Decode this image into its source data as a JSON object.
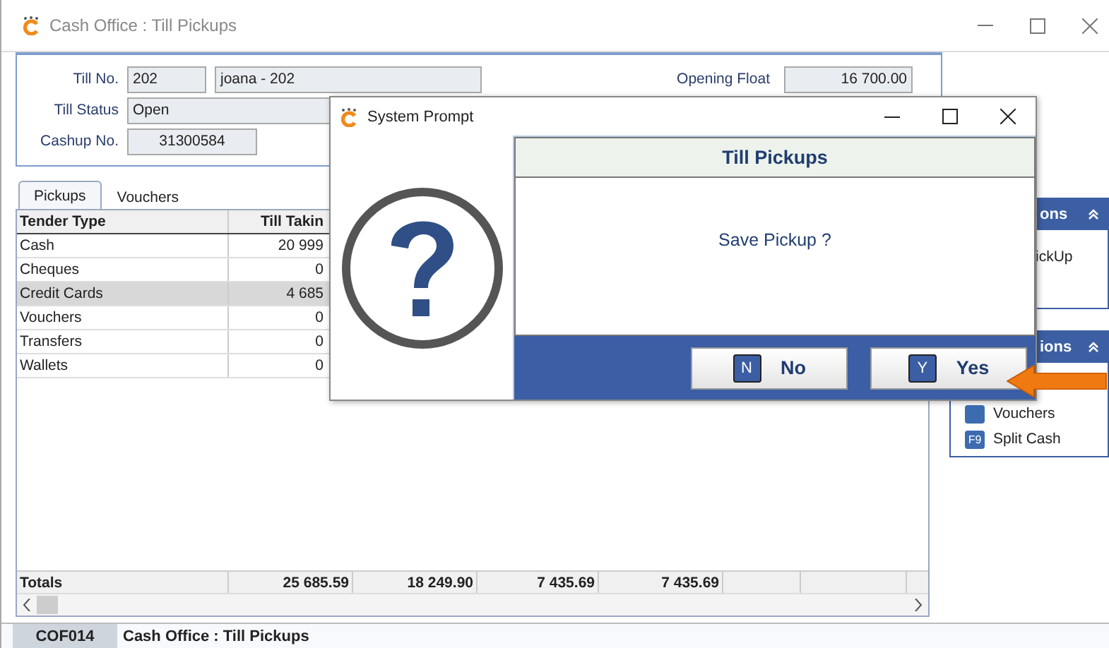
{
  "window": {
    "title": "Cash Office : Till Pickups"
  },
  "form": {
    "till_no": {
      "label": "Till No.",
      "value": "202",
      "name": "joana - 202"
    },
    "till_status": {
      "label": "Till Status",
      "value": "Open"
    },
    "cashup_no": {
      "label": "Cashup No.",
      "value": "31300584"
    },
    "opening_float": {
      "label": "Opening Float",
      "value": "16 700.00"
    }
  },
  "tabs": [
    {
      "label": "Pickups",
      "selected": true
    },
    {
      "label": "Vouchers",
      "selected": false
    }
  ],
  "table": {
    "columns": [
      "Tender Type",
      "Till Takin"
    ],
    "rows": [
      {
        "cells": [
          "Cash",
          "20 999"
        ],
        "selected": false
      },
      {
        "cells": [
          "Cheques",
          "0"
        ],
        "selected": false
      },
      {
        "cells": [
          "Credit Cards",
          "4 685"
        ],
        "selected": true
      },
      {
        "cells": [
          "Vouchers",
          "0"
        ],
        "selected": false
      },
      {
        "cells": [
          "Transfers",
          "0"
        ],
        "selected": false
      },
      {
        "cells": [
          "Wallets",
          "0"
        ],
        "selected": false
      }
    ],
    "totals": [
      "Totals",
      "25 685.59",
      "18 249.90",
      "7 435.69",
      "7 435.69"
    ]
  },
  "side_panels": [
    {
      "title": "ons",
      "items": [
        {
          "kind": "plain",
          "label": "ickUp"
        }
      ]
    },
    {
      "title": "ions",
      "items": [
        {
          "kind": "key",
          "label": "Vouchers"
        },
        {
          "kind": "key",
          "key": "F9",
          "label": "Split Cash"
        }
      ]
    }
  ],
  "dialog": {
    "title": "System Prompt",
    "heading": "Till Pickups",
    "message": "Save Pickup ?",
    "buttons": [
      {
        "key": "N",
        "label": "No"
      },
      {
        "key": "Y",
        "label": "Yes"
      }
    ]
  },
  "status_bar": {
    "code": "COF014",
    "title": "Cash Office : Till Pickups"
  }
}
